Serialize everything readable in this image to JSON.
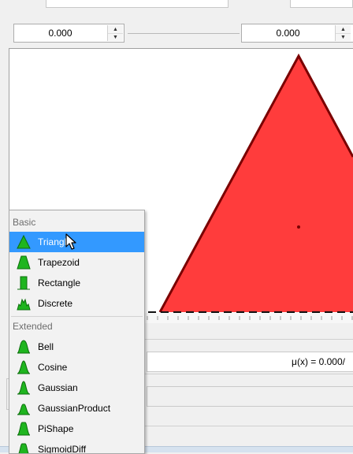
{
  "range_controls": {
    "min_value": "0.000",
    "max_value": "0.000"
  },
  "plot": {
    "term_shape": "Triangle",
    "fill_color": "#ff3c3c",
    "edge_color": "#7a0000"
  },
  "membership_readout": "μ(x) = 0.000/",
  "term_menu": {
    "sections": [
      {
        "header": "Basic",
        "items": [
          {
            "label": "Triangle",
            "icon": "triangle-icon",
            "selected": true
          },
          {
            "label": "Trapezoid",
            "icon": "trapezoid-icon"
          },
          {
            "label": "Rectangle",
            "icon": "rectangle-icon"
          },
          {
            "label": "Discrete",
            "icon": "discrete-icon"
          }
        ]
      },
      {
        "header": "Extended",
        "items": [
          {
            "label": "Bell",
            "icon": "bell-icon"
          },
          {
            "label": "Cosine",
            "icon": "cosine-icon"
          },
          {
            "label": "Gaussian",
            "icon": "gaussian-icon"
          },
          {
            "label": "GaussianProduct",
            "icon": "gaussian-product-icon"
          },
          {
            "label": "PiShape",
            "icon": "pi-shape-icon"
          },
          {
            "label": "SigmoidDiff",
            "icon": "sigmoid-difference-icon"
          }
        ]
      }
    ]
  },
  "colors": {
    "menu_selection": "#3399ff",
    "icon_green": "#1fb51f"
  }
}
